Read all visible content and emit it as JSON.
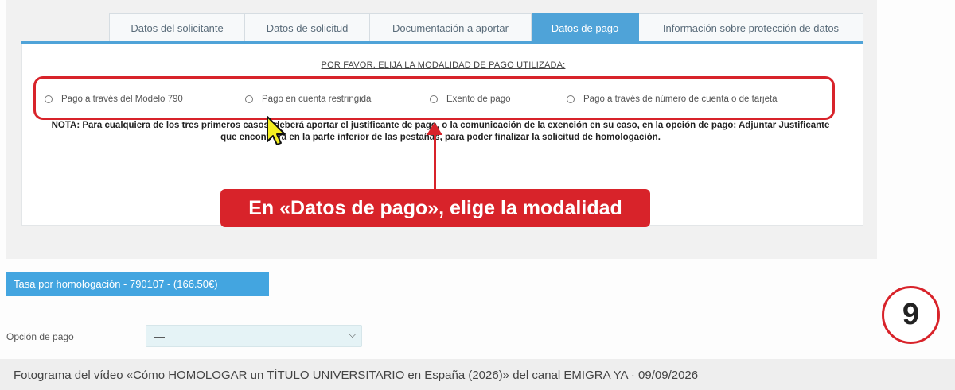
{
  "tabs": [
    {
      "label": "Datos del solicitante",
      "active": false
    },
    {
      "label": "Datos de solicitud",
      "active": false
    },
    {
      "label": "Documentación a aportar",
      "active": false
    },
    {
      "label": "Datos de pago",
      "active": true
    },
    {
      "label": "Información sobre protección de datos",
      "active": false
    }
  ],
  "payment": {
    "instruction": "POR FAVOR, ELIJA LA MODALIDAD DE PAGO UTILIZADA:",
    "options": [
      "Pago a través del Modelo 790",
      "Pago en cuenta restringida",
      "Exento de pago",
      "Pago a través de número de cuenta o de tarjeta"
    ]
  },
  "note": {
    "lead": "NOTA:",
    "text_1": " Para cualquiera de los tres primeros casos, deberá aportar el justificante de pago, o la comunicación de la exención en su caso, en la opción de pago: ",
    "link": "Adjuntar Justificante",
    "text_2": " que encontrará en la parte inferior de las pestañas, para poder finalizar la solicitud de homologación."
  },
  "callout": "En «Datos de pago», elige la modalidad",
  "tasa": "Tasa por homologación - 790107 - (166.50€)",
  "opcion_pago": {
    "label": "Opción de pago",
    "value": "—"
  },
  "step_number": "9",
  "caption": "Fotograma del vídeo «Cómo HOMOLOGAR un TÍTULO UNIVERSITARIO en España (2026)» del canal EMIGRA YA · 09/09/2026",
  "colors": {
    "accent_blue": "#4fa3d8",
    "highlight_red": "#d8232a",
    "cursor_yellow": "#f3ef22"
  },
  "icons": {
    "cursor": "mouse-pointer-icon",
    "arrow": "arrow-up-icon",
    "select": "chevron-down-icon"
  }
}
